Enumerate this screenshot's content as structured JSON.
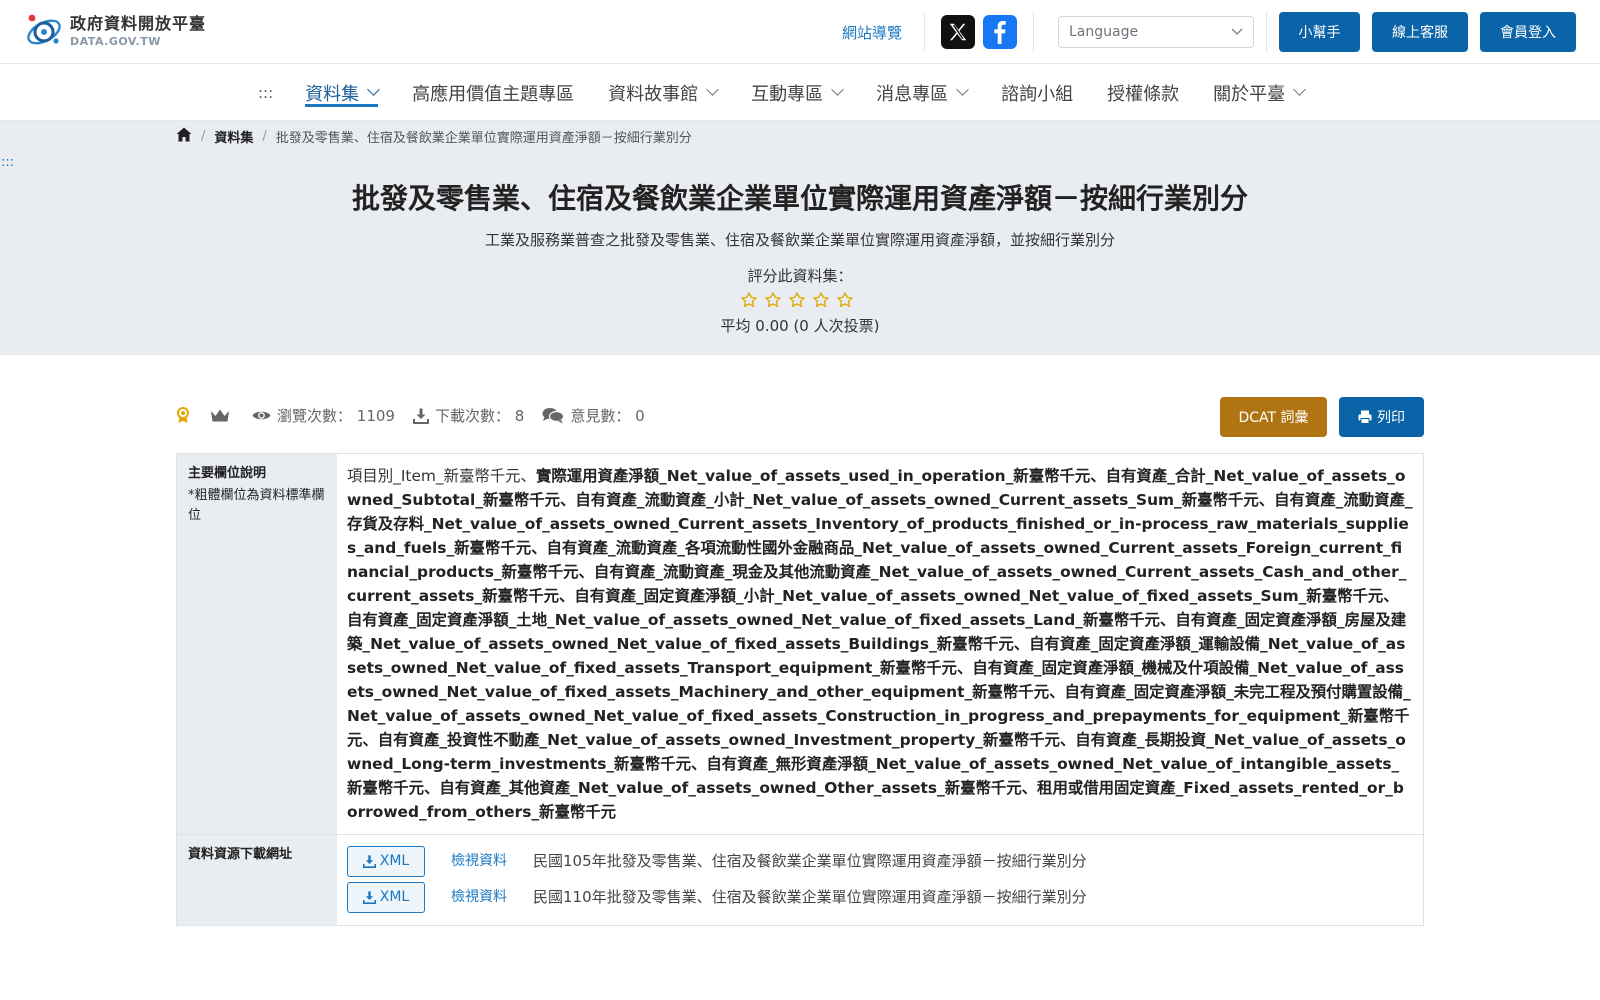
{
  "header": {
    "logo_title": "政府資料開放平臺",
    "logo_sub": "DATA.GOV.TW",
    "sitemap_label": "網站導覽",
    "language_placeholder": "Language",
    "helper_label": "小幫手",
    "service_label": "線上客服",
    "login_label": "會員登入"
  },
  "nav": {
    "accesskey": ":::",
    "items": [
      {
        "label": "資料集",
        "dropdown": true
      },
      {
        "label": "高應用價值主題專區",
        "dropdown": false
      },
      {
        "label": "資料故事館",
        "dropdown": true
      },
      {
        "label": "互動專區",
        "dropdown": true
      },
      {
        "label": "消息專區",
        "dropdown": true
      },
      {
        "label": "諮詢小組",
        "dropdown": false
      },
      {
        "label": "授權條款",
        "dropdown": false
      },
      {
        "label": "關於平臺",
        "dropdown": true
      }
    ]
  },
  "breadcrumb": {
    "section": "資料集",
    "current": "批發及零售業、住宿及餐飲業企業單位實際運用資產淨額－按細行業別分"
  },
  "side_accesskey": ":::",
  "dataset": {
    "title": "批發及零售業、住宿及餐飲業企業單位實際運用資產淨額－按細行業別分",
    "description": "工業及服務業普查之批發及零售業、住宿及餐飲業企業單位實際運用資產淨額，並按細行業別分",
    "rating_label": "評分此資料集：",
    "rating_average": "平均 0.00 (0 人次投票)",
    "rating_stars": 0
  },
  "stats": {
    "views_label": "瀏覽次數：",
    "views": "1109",
    "downloads_label": "下載次數：",
    "downloads": "8",
    "comments_label": "意見數：",
    "comments": "0"
  },
  "actions": {
    "dcat_label": "DCAT 詞彙",
    "print_label": "列印"
  },
  "fields": {
    "label": "主要欄位說明",
    "note": "*粗體欄位為資料標準欄位",
    "plain_part": "項目別_Item_新臺幣千元、",
    "bold_part": "實際運用資產淨額_Net_value_of_assets_used_in_operation_新臺幣千元、自有資產_合計_Net_value_of_assets_owned_Subtotal_新臺幣千元、自有資產_流動資產_小計_Net_value_of_assets_owned_Current_assets_Sum_新臺幣千元、自有資產_流動資產_存貨及存料_Net_value_of_assets_owned_Current_assets_Inventory_of_products_finished_or_in-process_raw_materials_supplies_and_fuels_新臺幣千元、自有資產_流動資產_各項流動性國外金融商品_Net_value_of_assets_owned_Current_assets_Foreign_current_financial_products_新臺幣千元、自有資產_流動資產_現金及其他流動資產_Net_value_of_assets_owned_Current_assets_Cash_and_other_current_assets_新臺幣千元、自有資產_固定資產淨額_小計_Net_value_of_assets_owned_Net_value_of_fixed_assets_Sum_新臺幣千元、自有資產_固定資產淨額_土地_Net_value_of_assets_owned_Net_value_of_fixed_assets_Land_新臺幣千元、自有資產_固定資產淨額_房屋及建築_Net_value_of_assets_owned_Net_value_of_fixed_assets_Buildings_新臺幣千元、自有資產_固定資產淨額_運輸設備_Net_value_of_assets_owned_Net_value_of_fixed_assets_Transport_equipment_新臺幣千元、自有資產_固定資產淨額_機械及什項設備_Net_value_of_assets_owned_Net_value_of_fixed_assets_Machinery_and_other_equipment_新臺幣千元、自有資產_固定資產淨額_未完工程及預付購置設備_Net_value_of_assets_owned_Net_value_of_fixed_assets_Construction_in_progress_and_prepayments_for_equipment_新臺幣千元、自有資產_投資性不動產_Net_value_of_assets_owned_Investment_property_新臺幣千元、自有資產_長期投資_Net_value_of_assets_owned_Long-term_investments_新臺幣千元、自有資產_無形資產淨額_Net_value_of_assets_owned_Net_value_of_intangible_assets_新臺幣千元、自有資產_其他資產_Net_value_of_assets_owned_Other_assets_新臺幣千元、租用或借用固定資產_Fixed_assets_rented_or_borrowed_from_others_新臺幣千元"
  },
  "resources": {
    "label": "資料資源下載網址",
    "items": [
      {
        "format": "XML",
        "view_label": "檢視資料",
        "name": "民國105年批發及零售業、住宿及餐飲業企業單位實際運用資產淨額－按細行業別分"
      },
      {
        "format": "XML",
        "view_label": "檢視資料",
        "name": "民國110年批發及零售業、住宿及餐飲業企業單位實際運用資產淨額－按細行業別分"
      }
    ]
  },
  "colors": {
    "primary": "#0c64a8",
    "link": "#1b78c0",
    "dcat": "#b07412",
    "hero_bg": "#e9edf1",
    "star": "#e0a800"
  },
  "icons": [
    "logo-icon",
    "x-icon",
    "facebook-icon",
    "chevron-down-icon",
    "home-icon",
    "star-outline-icon",
    "badge-icon",
    "crown-icon",
    "eye-icon",
    "download-icon",
    "comments-icon",
    "print-icon"
  ]
}
